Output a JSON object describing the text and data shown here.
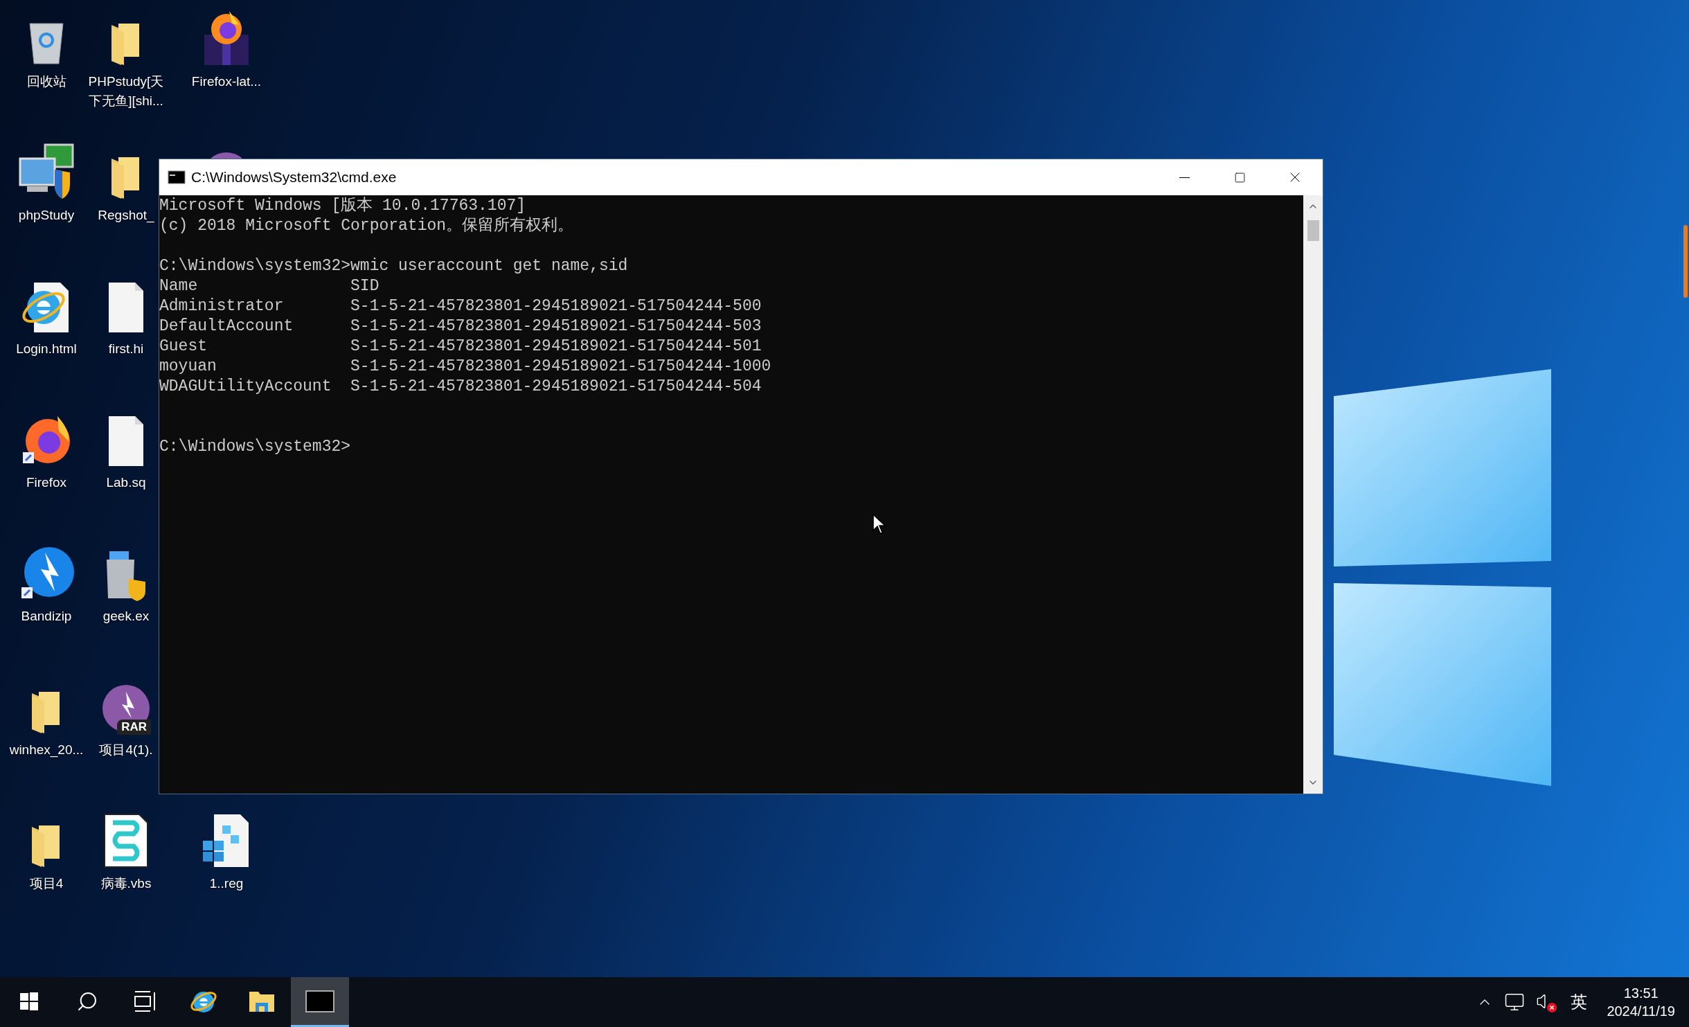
{
  "desktop": {
    "rows": [
      [
        {
          "kind": "recycle",
          "label": "回收站"
        },
        {
          "kind": "folder",
          "label": "PHPstudy[天下无鱼][shi..."
        },
        {
          "kind": "firefox-box",
          "label": "Firefox-lat..."
        }
      ],
      [
        {
          "kind": "phpstudy",
          "label": "phpStudy"
        },
        {
          "kind": "folder",
          "label": "Regshot_"
        },
        {
          "kind": "purple-circle"
        }
      ],
      [
        {
          "kind": "ie-file",
          "label": "Login.html"
        },
        {
          "kind": "blank-file",
          "label": "first.hi"
        }
      ],
      [
        {
          "kind": "firefox",
          "label": "Firefox"
        },
        {
          "kind": "blank-file",
          "label": "Lab.sq"
        }
      ],
      [
        {
          "kind": "bandizip",
          "label": "Bandizip"
        },
        {
          "kind": "geek",
          "label": "geek.ex"
        }
      ],
      [
        {
          "kind": "folder",
          "label": "winhex_20..."
        },
        {
          "kind": "rar",
          "label": "项目4(1).",
          "badge": "RAR"
        }
      ],
      [
        {
          "kind": "folder",
          "label": "项目4"
        },
        {
          "kind": "script",
          "label": "病毒.vbs"
        },
        {
          "kind": "reg",
          "label": "1..reg"
        }
      ]
    ]
  },
  "window": {
    "title": "C:\\Windows\\System32\\cmd.exe",
    "console": {
      "header": [
        "Microsoft Windows [版本 10.0.17763.107]",
        "(c) 2018 Microsoft Corporation。保留所有权利。"
      ],
      "command": "C:\\Windows\\system32>wmic useraccount get name,sid",
      "columns": [
        "Name",
        "SID"
      ],
      "rows": [
        {
          "name": "Administrator",
          "sid": "S-1-5-21-457823801-2945189021-517504244-500"
        },
        {
          "name": "DefaultAccount",
          "sid": "S-1-5-21-457823801-2945189021-517504244-503"
        },
        {
          "name": "Guest",
          "sid": "S-1-5-21-457823801-2945189021-517504244-501"
        },
        {
          "name": "moyuan",
          "sid": "S-1-5-21-457823801-2945189021-517504244-1000"
        },
        {
          "name": "WDAGUtilityAccount",
          "sid": "S-1-5-21-457823801-2945189021-517504244-504"
        }
      ],
      "prompt": "C:\\Windows\\system32>"
    }
  },
  "taskbar": {
    "items": [
      {
        "kind": "start",
        "selected": false
      },
      {
        "kind": "search",
        "selected": false
      },
      {
        "kind": "task-view",
        "selected": false
      },
      {
        "kind": "ie",
        "selected": false
      },
      {
        "kind": "explorer",
        "selected": false
      },
      {
        "kind": "console",
        "selected": true
      }
    ],
    "tray": {
      "ime": "英",
      "time": "13:51",
      "date": "2024/11/19",
      "muted": true
    }
  }
}
